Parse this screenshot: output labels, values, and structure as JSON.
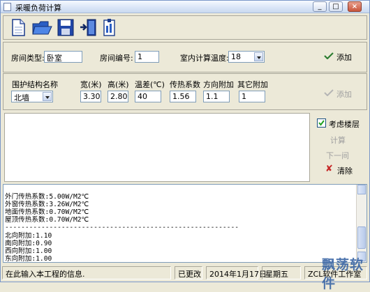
{
  "window": {
    "title": "采暖负荷计算"
  },
  "toolbar": {
    "icons": [
      "new-file-icon",
      "open-folder-icon",
      "save-disk-icon",
      "exit-door-icon",
      "report-icon"
    ]
  },
  "room": {
    "type_label": "房间类型:",
    "type_value": "卧室",
    "number_label": "房间编号:",
    "number_value": "1",
    "temp_label": "室内计算温度:",
    "temp_value": "18",
    "add_label": "添加"
  },
  "structure": {
    "name_label": "围护结构名称",
    "name_value": "北墙",
    "width_label": "宽(米)",
    "width_value": "3.30",
    "height_label": "高(米)",
    "height_value": "2.80",
    "tempdiff_label": "温差(℃)",
    "tempdiff_value": "40",
    "coef_label": "传热系数",
    "coef_value": "1.56",
    "dir_label": "方向附加",
    "dir_value": "1.1",
    "other_label": "其它附加",
    "other_value": "1",
    "add_label": "添加"
  },
  "side": {
    "floor_label": "考虑楼层",
    "calc_label": "计算",
    "next_label": "下一间",
    "clear_label": "清除"
  },
  "log": {
    "lines": [
      "外门传热系数:5.00W/M2℃",
      "外窗传热系数:3.26W/M2℃",
      "地面传热系数:0.70W/M2℃",
      "屋顶传热系数:0.70W/M2℃",
      "----------------------------------------------------------",
      "北向附加:1.10",
      "南向附加:0.90",
      "西向附加:1.00",
      "东向附加:1.00",
      "----------------------------------------------------------"
    ]
  },
  "status": {
    "message": "在此输入本工程的信息.",
    "modified": "已更改",
    "date": "2014年1月17日",
    "weekday": "星期五",
    "studio": "ZCL软件工作室"
  },
  "watermark": "飘荡软件",
  "colors": {
    "accent": "#3b67a6",
    "check_green": "#2e7d32",
    "clear_red": "#c62828"
  }
}
